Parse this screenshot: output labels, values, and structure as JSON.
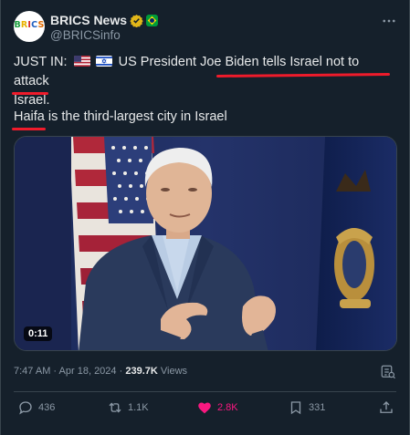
{
  "account": {
    "avatar_text": "BRICS",
    "name": "BRICS News",
    "handle": "@BRICSinfo"
  },
  "tweet": {
    "text_lead": "JUST IN:",
    "text_rest_line1": "US President Joe Biden tells Israel not to attack",
    "text_line2": "Israel.",
    "subtext": "Haifa is the third-largest city in Israel"
  },
  "media": {
    "duration": "0:11"
  },
  "meta": {
    "time": "7:47 AM",
    "sep": "·",
    "date": "Apr 18, 2024",
    "views_count": "239.7K",
    "views_label": "Views"
  },
  "actions": {
    "replies": "436",
    "reposts": "1.1K",
    "likes": "2.8K",
    "bookmarks": "331"
  },
  "colors": {
    "background": "#15202b",
    "text_secondary": "#8b98a5",
    "like_pink": "#f91880",
    "underline_red": "#ef1b2b"
  }
}
